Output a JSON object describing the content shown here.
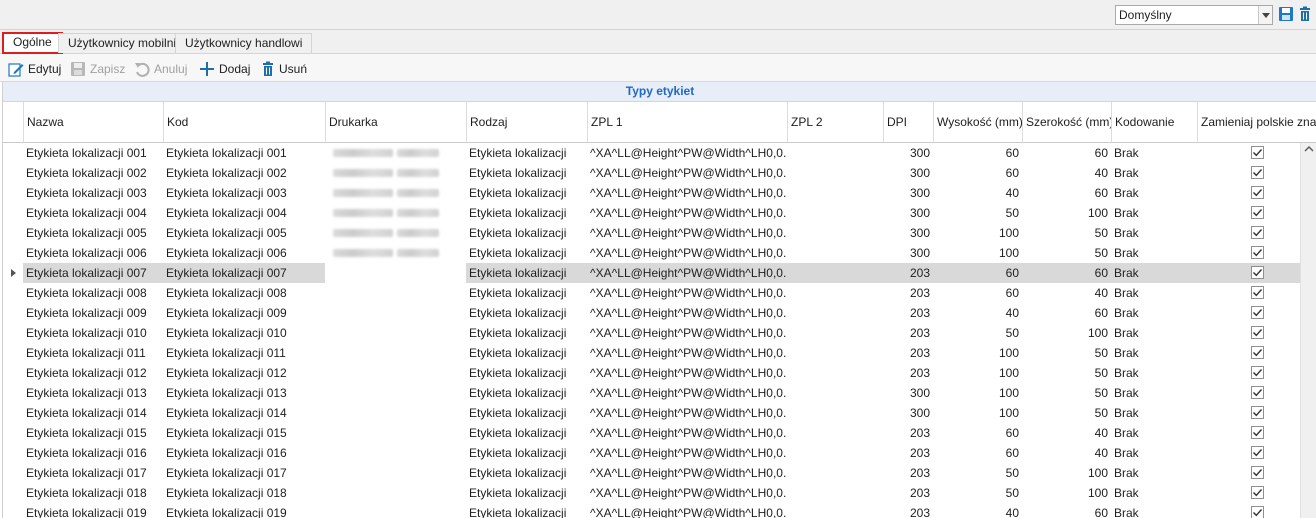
{
  "layout_selector": {
    "value": "Domyślny"
  },
  "tabs": [
    {
      "label": "Ogólne",
      "active": true
    },
    {
      "label": "Użytkownicy mobilni",
      "active": false
    },
    {
      "label": "Użytkownicy handlowi",
      "active": false
    }
  ],
  "toolbar": {
    "edit_label": "Edytuj",
    "save_label": "Zapisz",
    "cancel_label": "Anuluj",
    "add_label": "Dodaj",
    "delete_label": "Usuń"
  },
  "grid": {
    "title": "Typy etykiet",
    "columns": [
      "Nazwa",
      "Kod",
      "Drukarka",
      "Rodzaj",
      "ZPL 1",
      "ZPL 2",
      "DPI",
      "Wysokość (mm)",
      "Szerokość (mm)",
      "Kodowanie",
      "Zamieniaj polskie znaki"
    ],
    "selected_row_index": 6,
    "rows": [
      {
        "nazwa": "Etykieta lokalizacji 001",
        "kod": "Etykieta lokalizacji 001",
        "drukarka_blurred": true,
        "rodzaj": "Etykieta lokalizacji",
        "zpl1": "^XA^LL@Height^PW@Width^LH0,0...",
        "zpl2": "",
        "dpi": "300",
        "wys": "60",
        "szer": "60",
        "kod2": "Brak",
        "zamieniaj": true
      },
      {
        "nazwa": "Etykieta lokalizacji 002",
        "kod": "Etykieta lokalizacji 002",
        "drukarka_blurred": true,
        "rodzaj": "Etykieta lokalizacji",
        "zpl1": "^XA^LL@Height^PW@Width^LH0,0...",
        "zpl2": "",
        "dpi": "300",
        "wys": "60",
        "szer": "40",
        "kod2": "Brak",
        "zamieniaj": true
      },
      {
        "nazwa": "Etykieta lokalizacji 003",
        "kod": "Etykieta lokalizacji 003",
        "drukarka_blurred": true,
        "rodzaj": "Etykieta lokalizacji",
        "zpl1": "^XA^LL@Height^PW@Width^LH0,0...",
        "zpl2": "",
        "dpi": "300",
        "wys": "40",
        "szer": "60",
        "kod2": "Brak",
        "zamieniaj": true
      },
      {
        "nazwa": "Etykieta lokalizacji 004",
        "kod": "Etykieta lokalizacji 004",
        "drukarka_blurred": true,
        "rodzaj": "Etykieta lokalizacji",
        "zpl1": "^XA^LL@Height^PW@Width^LH0,0...",
        "zpl2": "",
        "dpi": "300",
        "wys": "50",
        "szer": "100",
        "kod2": "Brak",
        "zamieniaj": true
      },
      {
        "nazwa": "Etykieta lokalizacji 005",
        "kod": "Etykieta lokalizacji 005",
        "drukarka_blurred": true,
        "rodzaj": "Etykieta lokalizacji",
        "zpl1": "^XA^LL@Height^PW@Width^LH0,0...",
        "zpl2": "",
        "dpi": "300",
        "wys": "100",
        "szer": "50",
        "kod2": "Brak",
        "zamieniaj": true
      },
      {
        "nazwa": "Etykieta lokalizacji 006",
        "kod": "Etykieta lokalizacji 006",
        "drukarka_blurred": true,
        "rodzaj": "Etykieta lokalizacji",
        "zpl1": "^XA^LL@Height^PW@Width^LH0,0...",
        "zpl2": "",
        "dpi": "300",
        "wys": "100",
        "szer": "50",
        "kod2": "Brak",
        "zamieniaj": true
      },
      {
        "nazwa": "Etykieta lokalizacji 007",
        "kod": "Etykieta lokalizacji 007",
        "drukarka_blurred": false,
        "rodzaj": "Etykieta lokalizacji",
        "zpl1": "^XA^LL@Height^PW@Width^LH0,0...",
        "zpl2": "",
        "dpi": "203",
        "wys": "60",
        "szer": "60",
        "kod2": "Brak",
        "zamieniaj": true
      },
      {
        "nazwa": "Etykieta lokalizacji 008",
        "kod": "Etykieta lokalizacji 008",
        "drukarka_blurred": false,
        "rodzaj": "Etykieta lokalizacji",
        "zpl1": "^XA^LL@Height^PW@Width^LH0,0...",
        "zpl2": "",
        "dpi": "203",
        "wys": "60",
        "szer": "40",
        "kod2": "Brak",
        "zamieniaj": true
      },
      {
        "nazwa": "Etykieta lokalizacji 009",
        "kod": "Etykieta lokalizacji 009",
        "drukarka_blurred": false,
        "rodzaj": "Etykieta lokalizacji",
        "zpl1": "^XA^LL@Height^PW@Width^LH0,0...",
        "zpl2": "",
        "dpi": "203",
        "wys": "40",
        "szer": "60",
        "kod2": "Brak",
        "zamieniaj": true
      },
      {
        "nazwa": "Etykieta lokalizacji 010",
        "kod": "Etykieta lokalizacji 010",
        "drukarka_blurred": false,
        "rodzaj": "Etykieta lokalizacji",
        "zpl1": "^XA^LL@Height^PW@Width^LH0,0...",
        "zpl2": "",
        "dpi": "203",
        "wys": "50",
        "szer": "100",
        "kod2": "Brak",
        "zamieniaj": true
      },
      {
        "nazwa": "Etykieta lokalizacji 011",
        "kod": "Etykieta lokalizacji 011",
        "drukarka_blurred": false,
        "rodzaj": "Etykieta lokalizacji",
        "zpl1": "^XA^LL@Height^PW@Width^LH0,0...",
        "zpl2": "",
        "dpi": "203",
        "wys": "100",
        "szer": "50",
        "kod2": "Brak",
        "zamieniaj": true
      },
      {
        "nazwa": "Etykieta lokalizacji 012",
        "kod": "Etykieta lokalizacji 012",
        "drukarka_blurred": false,
        "rodzaj": "Etykieta lokalizacji",
        "zpl1": "^XA^LL@Height^PW@Width^LH0,0...",
        "zpl2": "",
        "dpi": "203",
        "wys": "100",
        "szer": "50",
        "kod2": "Brak",
        "zamieniaj": true
      },
      {
        "nazwa": "Etykieta lokalizacji 013",
        "kod": "Etykieta lokalizacji 013",
        "drukarka_blurred": false,
        "rodzaj": "Etykieta lokalizacji",
        "zpl1": "^XA^LL@Height^PW@Width^LH0,0...",
        "zpl2": "",
        "dpi": "300",
        "wys": "100",
        "szer": "50",
        "kod2": "Brak",
        "zamieniaj": true
      },
      {
        "nazwa": "Etykieta lokalizacji 014",
        "kod": "Etykieta lokalizacji 014",
        "drukarka_blurred": false,
        "rodzaj": "Etykieta lokalizacji",
        "zpl1": "^XA^LL@Height^PW@Width^LH0,0...",
        "zpl2": "",
        "dpi": "300",
        "wys": "100",
        "szer": "50",
        "kod2": "Brak",
        "zamieniaj": true
      },
      {
        "nazwa": "Etykieta lokalizacji 015",
        "kod": "Etykieta lokalizacji 015",
        "drukarka_blurred": false,
        "rodzaj": "Etykieta lokalizacji",
        "zpl1": "^XA^LL@Height^PW@Width^LH0,0...",
        "zpl2": "",
        "dpi": "203",
        "wys": "60",
        "szer": "40",
        "kod2": "Brak",
        "zamieniaj": true
      },
      {
        "nazwa": "Etykieta lokalizacji 016",
        "kod": "Etykieta lokalizacji 016",
        "drukarka_blurred": false,
        "rodzaj": "Etykieta lokalizacji",
        "zpl1": "^XA^LL@Height^PW@Width^LH0,0...",
        "zpl2": "",
        "dpi": "203",
        "wys": "60",
        "szer": "40",
        "kod2": "Brak",
        "zamieniaj": true
      },
      {
        "nazwa": "Etykieta lokalizacji 017",
        "kod": "Etykieta lokalizacji 017",
        "drukarka_blurred": false,
        "rodzaj": "Etykieta lokalizacji",
        "zpl1": "^XA^LL@Height^PW@Width^LH0,0...",
        "zpl2": "",
        "dpi": "203",
        "wys": "50",
        "szer": "100",
        "kod2": "Brak",
        "zamieniaj": true
      },
      {
        "nazwa": "Etykieta lokalizacji 018",
        "kod": "Etykieta lokalizacji 018",
        "drukarka_blurred": false,
        "rodzaj": "Etykieta lokalizacji",
        "zpl1": "^XA^LL@Height^PW@Width^LH0,0...",
        "zpl2": "",
        "dpi": "203",
        "wys": "50",
        "szer": "100",
        "kod2": "Brak",
        "zamieniaj": true
      },
      {
        "nazwa": "Etykieta lokalizacji 019",
        "kod": "Etykieta lokalizacji 019",
        "drukarka_blurred": false,
        "rodzaj": "Etykieta lokalizacji",
        "zpl1": "^XA^LL@Height^PW@Width^LH0,0...",
        "zpl2": "",
        "dpi": "203",
        "wys": "40",
        "szer": "60",
        "kod2": "Brak",
        "zamieniaj": true
      }
    ]
  },
  "colors": {
    "accent_blue": "#2068c8",
    "active_tab_border": "#e01d1d",
    "selected_row": "#d9d9d9"
  },
  "icons": {
    "save_layout": "floppy-disk-icon",
    "delete_layout": "trash-icon",
    "edit": "pencil-icon",
    "save": "floppy-disk-icon",
    "cancel": "undo-icon",
    "add": "plus-icon",
    "delete": "trash-icon"
  }
}
